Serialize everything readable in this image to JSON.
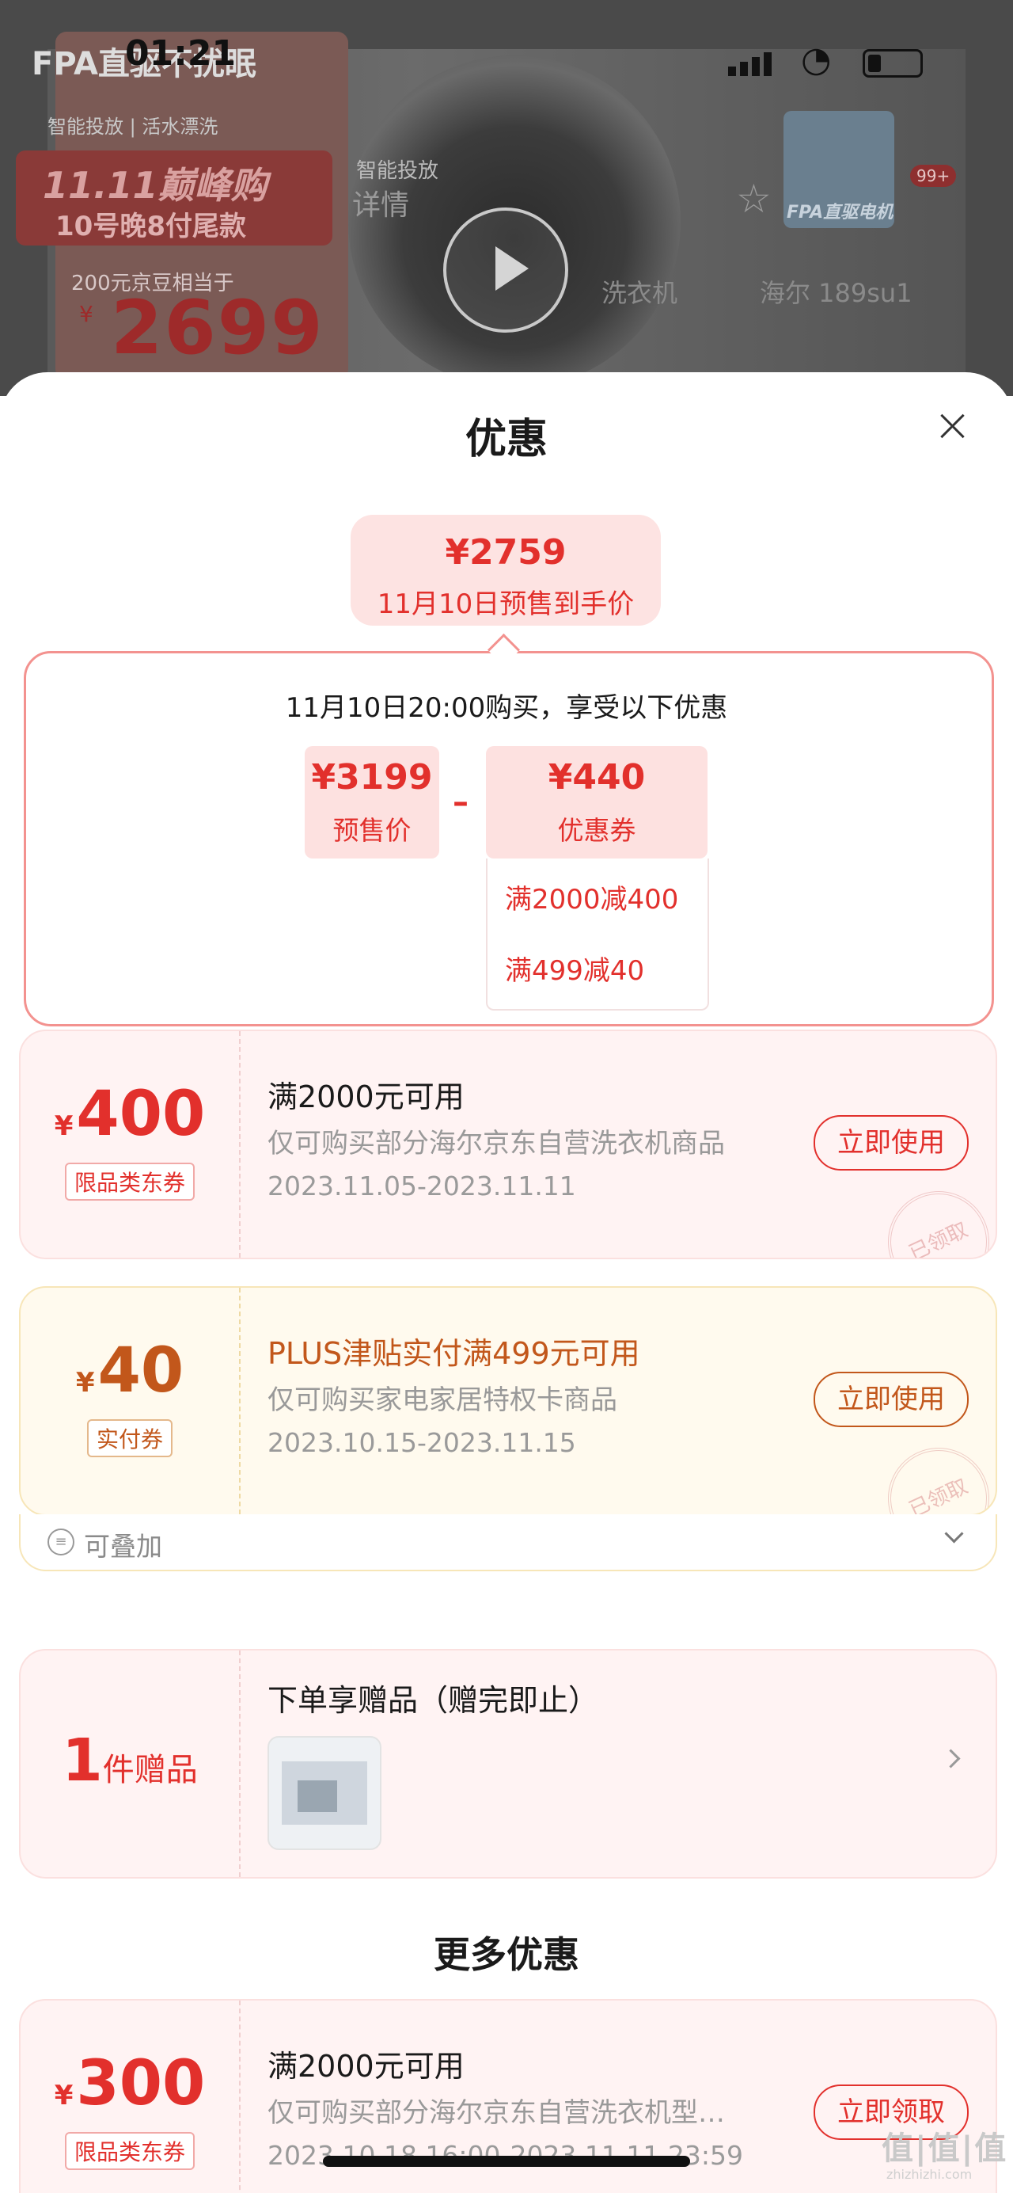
{
  "background": {
    "status_time": "01:21",
    "promo_line1": "FPA直驱不扰眠",
    "promo_line2": "智能投放 | 活水漂洗",
    "promo_sale_line1": "11.11巅峰购",
    "promo_sale_line2": "10号晚8付尾款",
    "promo_note": "200元京豆相当于",
    "promo_price": "2699",
    "tag_label": "智能投放",
    "nav_detail": "详情",
    "crumb1": "洗衣机",
    "crumb2": "海尔 189su1",
    "motor_label": "FPA直驱电机",
    "badge": "99+"
  },
  "sheet": {
    "title": "优惠",
    "final_price": "¥2759",
    "final_price_label": "11月10日预售到手价",
    "calc_heading": "11月10日20:00购买，享受以下优惠",
    "presale_amount": "¥3199",
    "presale_label": "预售价",
    "minus": "–",
    "coupon_amount": "¥440",
    "coupon_label": "优惠券",
    "coupon_rows": [
      "满2000减400",
      "满499减40"
    ]
  },
  "coupons": [
    {
      "currency": "¥",
      "amount": "400",
      "tag": "限品类东券",
      "title": "满2000元可用",
      "desc": "仅可购买部分海尔京东自营洗衣机商品",
      "date": "2023.11.05-2023.11.11",
      "button": "立即使用",
      "stamp": "已领取"
    },
    {
      "currency": "¥",
      "amount": "40",
      "tag": "实付券",
      "title": "PLUS津贴实付满499元可用",
      "desc": "仅可购买家电家居特权卡商品",
      "date": "2023.10.15-2023.11.15",
      "button": "立即使用",
      "stamp": "已领取",
      "stackable_label": "可叠加"
    }
  ],
  "gift": {
    "count": "1",
    "unit": "件赠品",
    "title": "下单享赠品（赠完即止）"
  },
  "more": {
    "heading": "更多优惠",
    "coupon": {
      "currency": "¥",
      "amount": "300",
      "tag": "限品类东券",
      "title": "满2000元可用",
      "desc": "仅可购买部分海尔京东自营洗衣机型…",
      "date": "2023.10.18 16:00-2023.11.11 23:59",
      "button": "立即领取"
    }
  },
  "watermark": {
    "text": "值|值|值",
    "sub": "zhizhizhi.com"
  },
  "colors": {
    "accent_red": "#e2302c",
    "accent_gold": "#c2571b",
    "pink_bg": "#fff3f3",
    "gold_bg": "#fffaee"
  }
}
